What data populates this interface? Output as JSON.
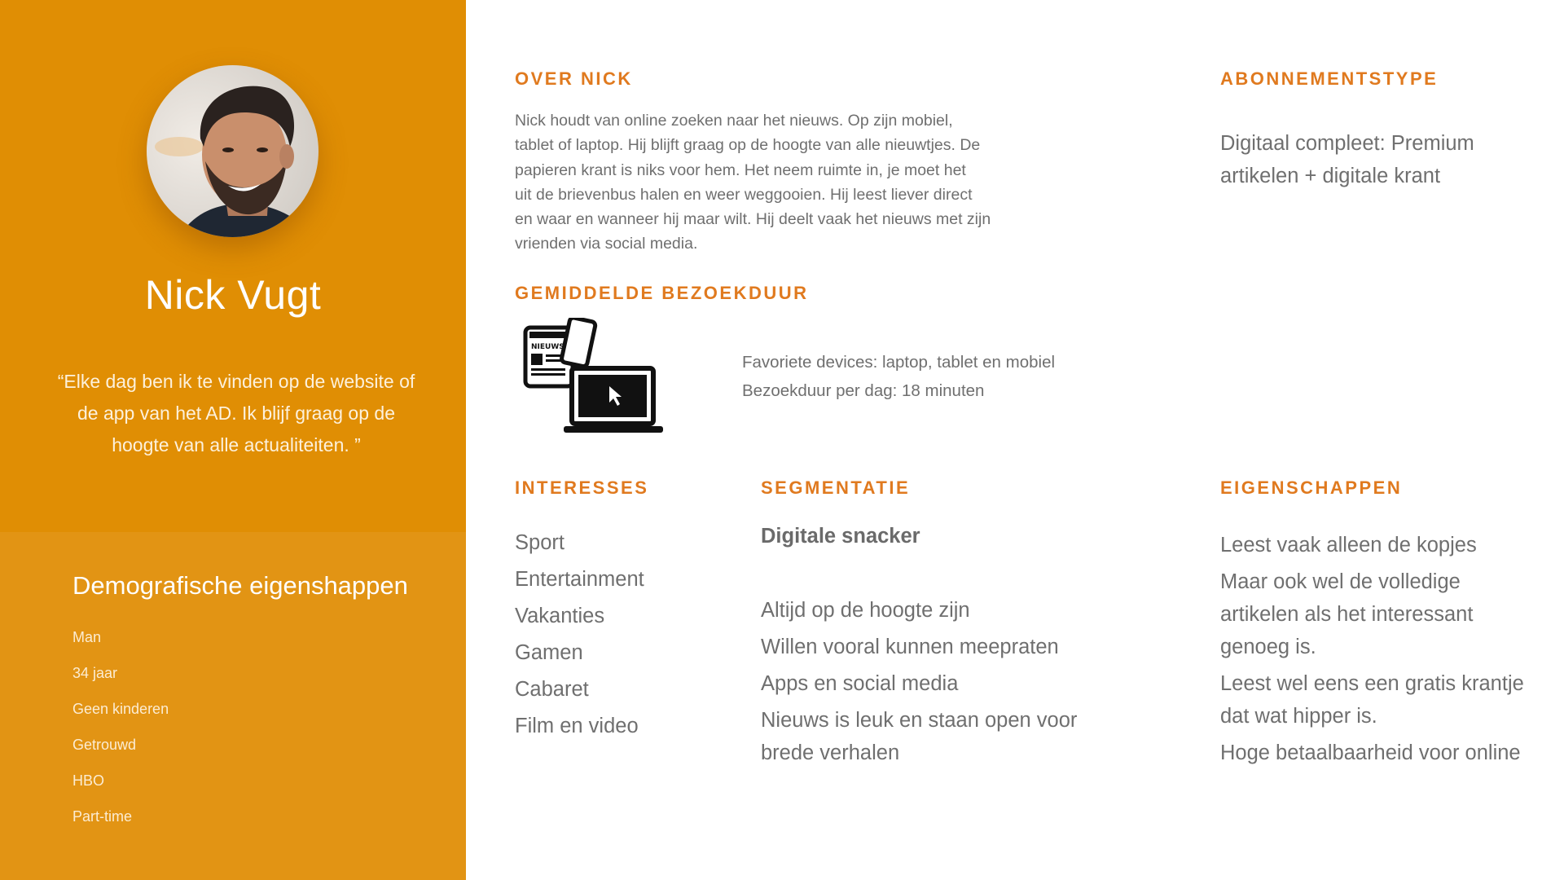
{
  "profile": {
    "name": "Nick Vugt",
    "quote": "“Elke dag ben ik te vinden op de website of de app van het AD. Ik blijf graag op de hoogte van alle actualiteiten. ”"
  },
  "demographics": {
    "title": "Demografische eigenshappen",
    "items": [
      "Man",
      "34 jaar",
      "Geen kinderen",
      "Getrouwd",
      "HBO",
      "Part-time"
    ]
  },
  "about": {
    "heading": "OVER NICK",
    "lines": [
      "Nick houdt van online zoeken naar het nieuws. Op zijn mobiel,",
      "tablet of laptop. Hij blijft graag op de hoogte van alle nieuwtjes. De",
      "papieren krant is niks voor hem. Het neem ruimte in, je moet het",
      "uit de brievenbus halen en weer weggooien. Hij leest liever direct",
      "en waar en wanneer hij maar wilt. Hij deelt vaak het nieuws met zijn",
      "vrienden via social media."
    ]
  },
  "subscription": {
    "heading": "ABONNEMENTSTYPE",
    "lines": [
      "Digitaal compleet: Premium",
      "artikelen + digitale krant"
    ]
  },
  "visit": {
    "heading": "GEMIDDELDE BEZOEKDUUR",
    "icon_label": "NIEUWS",
    "devices": "Favoriete devices: laptop, tablet en mobiel",
    "duration": "Bezoekduur per dag: 18 minuten"
  },
  "interests": {
    "heading": "INTERESSES",
    "items": [
      "Sport",
      "Entertainment",
      "Vakanties",
      "Gamen",
      "Cabaret",
      "Film en video"
    ]
  },
  "segmentation": {
    "heading": "SEGMENTATIE",
    "segment": "Digitale snacker",
    "items": [
      [
        "Altijd op de hoogte zijn"
      ],
      [
        "Willen vooral kunnen meepraten"
      ],
      [
        "Apps en social media"
      ],
      [
        "Nieuws is leuk en staan open voor",
        "brede verhalen"
      ]
    ]
  },
  "properties": {
    "heading": "EIGENSCHAPPEN",
    "items": [
      [
        "Leest vaak alleen de kopjes"
      ],
      [
        "Maar ook wel de volledige",
        "artikelen als het interessant",
        "genoeg is."
      ],
      [
        "Leest wel eens een gratis krantje",
        "dat wat hipper is."
      ],
      [
        "Hoge betaalbaarheid voor online"
      ]
    ]
  },
  "colors": {
    "panel_top": "#e08e04",
    "panel_bottom": "#e29414",
    "heading": "#e07a1f",
    "body_text": "#6f6f6f"
  }
}
